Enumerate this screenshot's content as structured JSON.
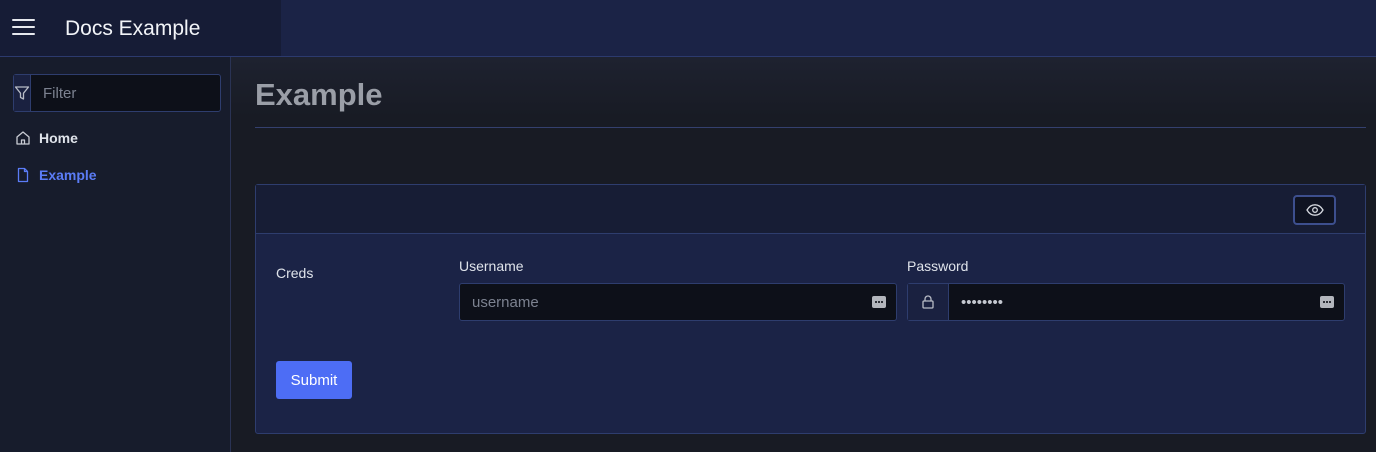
{
  "app": {
    "title": "Docs Example"
  },
  "icons": {
    "menu": "hamburger-menu-icon",
    "filter": "filter-funnel-icon",
    "home": "home-icon",
    "page": "document-icon",
    "eye": "eye-icon",
    "lock": "lock-icon",
    "password_manager": "password-manager-key-icon"
  },
  "sidebar": {
    "filter_placeholder": "Filter",
    "items": [
      {
        "label": "Home",
        "active": false
      },
      {
        "label": "Example",
        "active": true
      }
    ]
  },
  "main": {
    "page_title": "Example",
    "form": {
      "group_label": "Creds",
      "username": {
        "label": "Username",
        "placeholder": "username",
        "value": ""
      },
      "password": {
        "label": "Password",
        "value": "••••••••"
      },
      "submit_label": "Submit"
    }
  },
  "colors": {
    "accent": "#4d6df5",
    "active_nav": "#5b7cf6",
    "topbar": "#1b2346",
    "card": "#1b2346",
    "border": "#2e3d6e"
  }
}
